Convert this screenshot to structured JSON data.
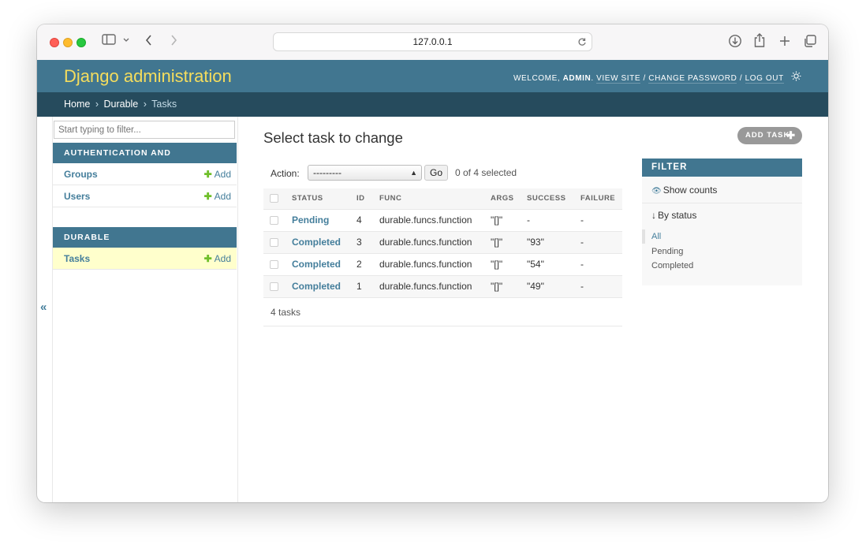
{
  "browser": {
    "url": "127.0.0.1",
    "icons": [
      "sidebar-toggle-icon",
      "chevron-down-icon",
      "back-arrow-icon",
      "forward-arrow-icon",
      "reload-icon",
      "download-icon",
      "share-icon",
      "new-tab-plus-icon",
      "tab-overview-icon"
    ]
  },
  "header": {
    "brand": "Django administration",
    "welcome": "Welcome,",
    "username": "admin",
    "view_site": "View site",
    "change_password": "Change password",
    "log_out": "Log out",
    "theme_icon": "sun-icon"
  },
  "breadcrumbs": {
    "home": "Home",
    "app": "Durable",
    "current": "Tasks",
    "separator": "›"
  },
  "sidebar": {
    "filter_placeholder": "Start typing to filter...",
    "apps": [
      {
        "caption": "Authentication and Authorization",
        "models": [
          {
            "name": "Groups",
            "add": "Add"
          },
          {
            "name": "Users",
            "add": "Add"
          }
        ]
      },
      {
        "caption": "Durable",
        "models": [
          {
            "name": "Tasks",
            "add": "Add",
            "selected": true
          }
        ]
      }
    ],
    "collapse_label": "«"
  },
  "content": {
    "title": "Select task to change",
    "add_button": "Add task",
    "actions": {
      "label": "Action:",
      "selected_option": "---------",
      "go": "Go",
      "counter": "0 of 4 selected"
    },
    "table": {
      "columns": [
        "Status",
        "ID",
        "Func",
        "Args",
        "Success",
        "Failure"
      ],
      "rows": [
        {
          "status": "Pending",
          "id": "4",
          "func": "durable.funcs.function",
          "args": "\"[]\"",
          "success": "-",
          "failure": "-"
        },
        {
          "status": "Completed",
          "id": "3",
          "func": "durable.funcs.function",
          "args": "\"[]\"",
          "success": "\"93\"",
          "failure": "-"
        },
        {
          "status": "Completed",
          "id": "2",
          "func": "durable.funcs.function",
          "args": "\"[]\"",
          "success": "\"54\"",
          "failure": "-"
        },
        {
          "status": "Completed",
          "id": "1",
          "func": "durable.funcs.function",
          "args": "\"[]\"",
          "success": "\"49\"",
          "failure": "-"
        }
      ]
    },
    "paginator": "4 tasks"
  },
  "filter": {
    "title": "Filter",
    "show_counts": "Show counts",
    "by_status": "By status",
    "options": [
      "All",
      "Pending",
      "Completed"
    ],
    "selected": "All"
  },
  "colors": {
    "primary": "#417690",
    "secondary": "#264b5d",
    "accent": "#f5dd5d",
    "link": "#447e9b",
    "selected_row": "#ffffcc",
    "add_green": "#70bf2b"
  }
}
